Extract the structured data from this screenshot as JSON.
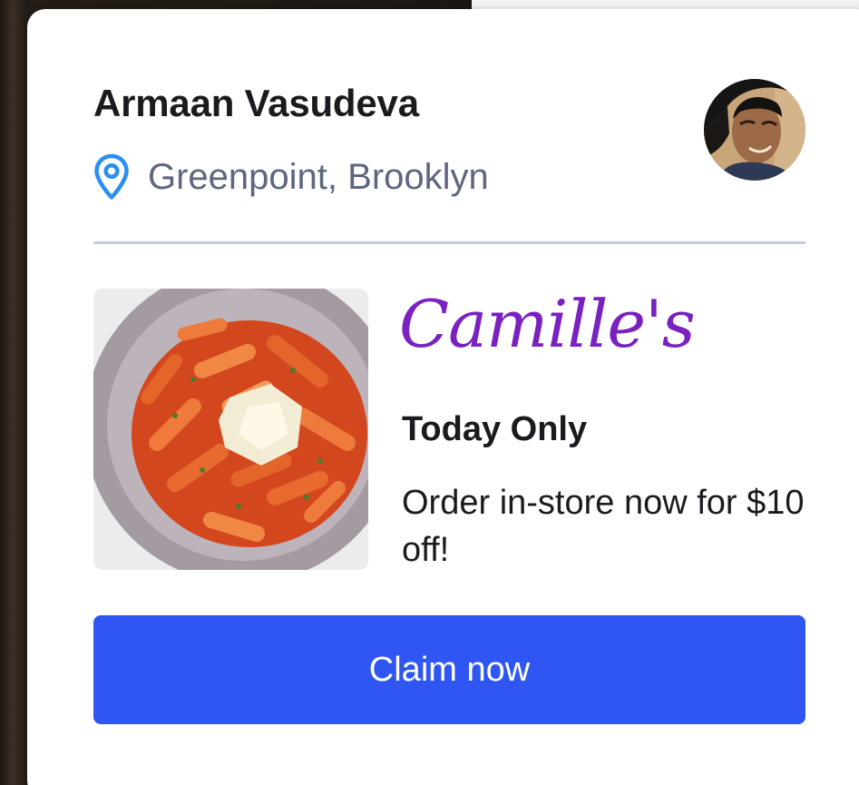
{
  "user": {
    "name": "Armaan Vasudeva",
    "location": "Greenpoint, Brooklyn",
    "avatar_icon": "avatar-photo"
  },
  "offer": {
    "restaurant": "Camille's",
    "title": "Today Only",
    "description": "Order in-store now for $10 off!",
    "image_icon": "penne-pasta-photo",
    "cta_label": "Claim now"
  },
  "colors": {
    "accent": "#2f56f2",
    "restaurant_name": "#7a21c0",
    "location_pin": "#2a8ff0",
    "location_text": "#5e6680",
    "divider": "#c4cce3"
  }
}
